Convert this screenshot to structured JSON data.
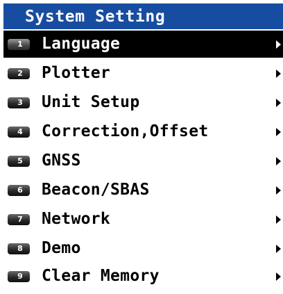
{
  "title": "System Setting",
  "items": [
    {
      "number": "1",
      "label": "Language",
      "has_submenu": true,
      "selected": true
    },
    {
      "number": "2",
      "label": "Plotter",
      "has_submenu": true,
      "selected": false
    },
    {
      "number": "3",
      "label": "Unit Setup",
      "has_submenu": true,
      "selected": false
    },
    {
      "number": "4",
      "label": "Correction,Offset",
      "has_submenu": true,
      "selected": false
    },
    {
      "number": "5",
      "label": "GNSS",
      "has_submenu": true,
      "selected": false
    },
    {
      "number": "6",
      "label": "Beacon/SBAS",
      "has_submenu": true,
      "selected": false
    },
    {
      "number": "7",
      "label": "Network",
      "has_submenu": true,
      "selected": false
    },
    {
      "number": "8",
      "label": "Demo",
      "has_submenu": true,
      "selected": false
    },
    {
      "number": "9",
      "label": "Clear Memory",
      "has_submenu": true,
      "selected": false
    }
  ],
  "colors": {
    "title_bar": "#174da0",
    "selected_row": "#000000"
  },
  "icons": {
    "number_key": "number-key-icon",
    "submenu_arrow": "chevron-right-icon"
  }
}
